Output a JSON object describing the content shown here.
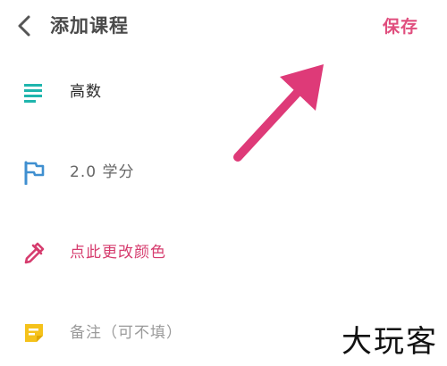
{
  "header": {
    "title": "添加课程",
    "save_label": "保存",
    "back_icon": "chevron-left-icon"
  },
  "form": {
    "name": {
      "icon": "notes-list-icon",
      "value": "高数",
      "color": "#2a2a2a"
    },
    "credit": {
      "icon": "flag-icon",
      "value": "2.0 学分",
      "color": "#666666"
    },
    "color_picker": {
      "icon": "eyedropper-icon",
      "label": "点此更改颜色",
      "color": "#d63c6e"
    },
    "note": {
      "icon": "sticky-note-icon",
      "placeholder": "备注（可不填）",
      "color": "#9a9a9a"
    }
  },
  "watermark": "大玩客",
  "colors": {
    "accent": "#e04e7e",
    "teal": "#1fb5ad",
    "blue": "#3f8fd0",
    "yellow": "#f5c21b",
    "pink_arrow": "#de3a78"
  }
}
